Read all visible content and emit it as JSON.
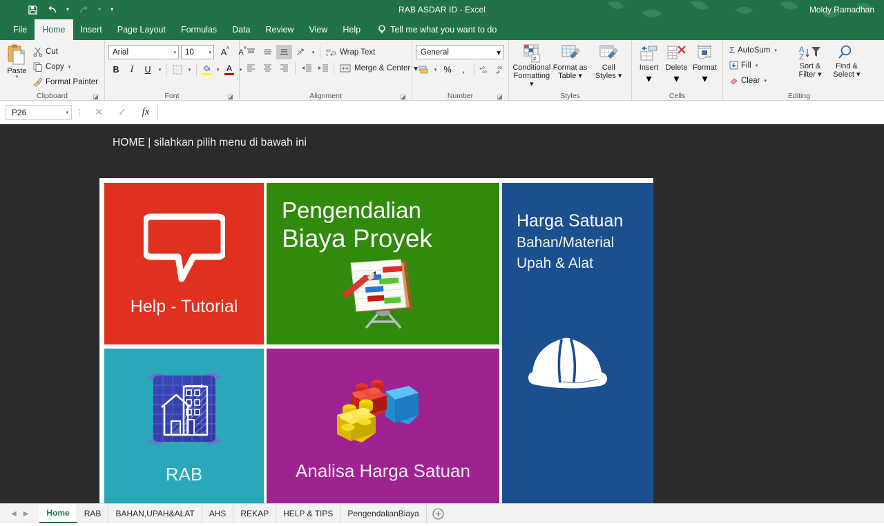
{
  "titlebar": {
    "document_title": "RAB ASDAR ID  -  Excel",
    "user_name": "Moldy Ramadhan",
    "qat": {
      "save": "save-icon",
      "undo": "undo-icon",
      "redo": "redo-icon",
      "customize": "customize-qat-icon"
    }
  },
  "ribbon_tabs": {
    "items": [
      {
        "label": "File",
        "active": false
      },
      {
        "label": "Home",
        "active": true
      },
      {
        "label": "Insert",
        "active": false
      },
      {
        "label": "Page Layout",
        "active": false
      },
      {
        "label": "Formulas",
        "active": false
      },
      {
        "label": "Data",
        "active": false
      },
      {
        "label": "Review",
        "active": false
      },
      {
        "label": "View",
        "active": false
      },
      {
        "label": "Help",
        "active": false
      }
    ],
    "tell_me": "Tell me what you want to do"
  },
  "ribbon": {
    "clipboard": {
      "group_label": "Clipboard",
      "paste": "Paste",
      "cut": "Cut",
      "copy": "Copy",
      "format_painter": "Format Painter"
    },
    "font": {
      "group_label": "Font",
      "font_name": "Arial",
      "font_size": "10",
      "grow": "A",
      "shrink": "A",
      "bold": "B",
      "italic": "I",
      "underline": "U",
      "font_color_hex": "#c00000",
      "highlight_hex": "#ffff00"
    },
    "alignment": {
      "group_label": "Alignment",
      "wrap_text": "Wrap Text",
      "merge_center": "Merge & Center"
    },
    "number": {
      "group_label": "Number",
      "format": "General",
      "percent": "%",
      "comma": ",",
      "increase_decimal": ".00",
      "decrease_decimal": ".00"
    },
    "styles": {
      "group_label": "Styles",
      "conditional_formatting": "Conditional\nFormatting",
      "conditional_formatting_l1": "Conditional",
      "conditional_formatting_l2": "Formatting",
      "format_as_table_l1": "Format as",
      "format_as_table_l2": "Table",
      "cell_styles_l1": "Cell",
      "cell_styles_l2": "Styles"
    },
    "cells": {
      "group_label": "Cells",
      "insert": "Insert",
      "delete": "Delete",
      "format": "Format"
    },
    "editing": {
      "group_label": "Editing",
      "autosum": "AutoSum",
      "fill": "Fill",
      "clear": "Clear",
      "sort_filter_l1": "Sort &",
      "sort_filter_l2": "Filter",
      "find_select_l1": "Find &",
      "find_select_l2": "Select"
    }
  },
  "formula_bar": {
    "name_box": "P26",
    "cancel_icon": "close-icon",
    "enter_icon": "check-icon",
    "function_icon": "fx",
    "formula_value": ""
  },
  "sheet": {
    "heading": "HOME | silahkan pilih menu di bawah ini",
    "background_hex": "#2b2b2b",
    "panel_background_hex": "#ffffff",
    "tiles": [
      {
        "id": "help-tutorial",
        "label": "Help - Tutorial",
        "color_hex": "#e0301e",
        "icon": "speech-bubble-icon"
      },
      {
        "id": "pengendalian-biaya-proyek",
        "line1": "Pengendalian",
        "line2": "Biaya Proyek",
        "color_hex": "#308a0c",
        "icon": "gantt-chart-flipchart-icon"
      },
      {
        "id": "harga-satuan",
        "line1": "Harga Satuan",
        "line2": "Bahan/Material",
        "line3": "Upah & Alat",
        "color_hex": "#1b4f8f",
        "icon": "hard-hat-icon"
      },
      {
        "id": "rab",
        "label": "RAB",
        "color_hex": "#2aa7b8",
        "icon": "blueprint-building-icon"
      },
      {
        "id": "analisa-harga-satuan",
        "label": "Analisa Harga Satuan",
        "color_hex": "#9e2390",
        "icon": "lego-bricks-icon"
      }
    ]
  },
  "sheet_tabs": {
    "prev_icon": "chevron-left-icon",
    "next_icon": "chevron-right-icon",
    "add_icon": "plus-circle-icon",
    "items": [
      {
        "label": "Home",
        "active": true
      },
      {
        "label": "RAB",
        "active": false
      },
      {
        "label": "BAHAN,UPAH&ALAT",
        "active": false
      },
      {
        "label": "AHS",
        "active": false
      },
      {
        "label": "REKAP",
        "active": false
      },
      {
        "label": "HELP & TIPS",
        "active": false
      },
      {
        "label": "PengendalianBiaya",
        "active": false
      }
    ]
  }
}
